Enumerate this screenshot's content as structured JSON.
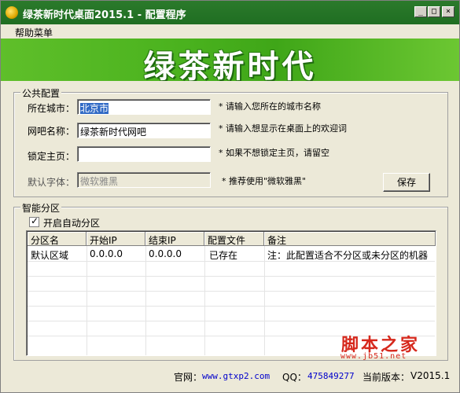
{
  "window": {
    "title": "绿茶新时代桌面2015.1 - 配置程序",
    "minimize": "_",
    "maximize": "□",
    "close": "×"
  },
  "menu": {
    "help": "帮助菜单"
  },
  "banner": {
    "text": "绿茶新时代"
  },
  "public_config": {
    "legend": "公共配置",
    "city_label": "所在城市：",
    "city_value": "北京市",
    "city_hint": "* 请输入您所在的城市名称",
    "netbar_label": "网吧名称：",
    "netbar_value": "绿茶新时代网吧",
    "netbar_hint": "* 请输入想显示在桌面上的欢迎词",
    "homepage_label": "锁定主页：",
    "homepage_value": "",
    "homepage_hint": "* 如果不想锁定主页，请留空",
    "font_label": "默认字体：",
    "font_value": "微软雅黑",
    "font_hint": "* 推荐使用\"微软雅黑\"",
    "save_button": "保存"
  },
  "smart_partition": {
    "legend": "智能分区",
    "auto_label": "开启自动分区",
    "auto_checked": true,
    "columns": [
      "分区名",
      "开始IP",
      "结束IP",
      "配置文件",
      "备注"
    ],
    "rows": [
      [
        "默认区域",
        "0.0.0.0",
        "0.0.0.0",
        "已存在",
        "注：此配置适合不分区或未分区的机器"
      ]
    ]
  },
  "status": {
    "website_label": "官网：",
    "website": "www.gtxp2.com",
    "qq_label": "QQ：",
    "qq": "475849277",
    "version_label": "当前版本：",
    "version": "V2015.1"
  },
  "watermark": {
    "text": "脚本之家",
    "url": "www.jb51.net"
  },
  "colors": {
    "title_bar": "#1f6e22",
    "banner": "#4ab21e",
    "selection": "#316ac5",
    "link": "#0000cc",
    "watermark": "#d6281c"
  }
}
